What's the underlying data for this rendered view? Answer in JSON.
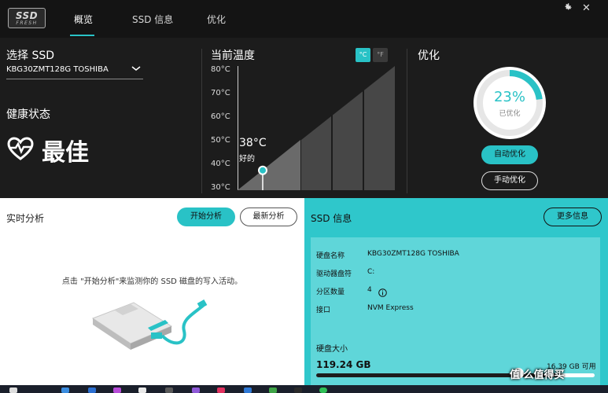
{
  "header": {
    "logo_line1": "SSD",
    "logo_line2": "FRESH",
    "tabs": [
      {
        "label": "概览",
        "active": true
      },
      {
        "label": "SSD 信息",
        "active": false
      },
      {
        "label": "优化",
        "active": false
      }
    ],
    "settings_icon": "gear-icon",
    "close_icon": "close-icon",
    "close_glyph": "✕"
  },
  "select_ssd": {
    "title": "选择 SSD",
    "value": "KBG30ZMT128G TOSHIBA"
  },
  "health": {
    "title": "健康状态",
    "status": "最佳",
    "icon": "heart-pulse-icon"
  },
  "temperature": {
    "title": "当前温度",
    "units": [
      "°C",
      "°F"
    ],
    "active_unit": "°C",
    "ticks": [
      "80°C",
      "70°C",
      "60°C",
      "50°C",
      "40°C",
      "30°C"
    ],
    "current": "38°C",
    "state": "好的",
    "current_value": 38,
    "range": [
      30,
      80
    ]
  },
  "optimize": {
    "title": "优化",
    "percent_text": "23%",
    "percent": 23,
    "label": "已优化",
    "auto_label": "自动优化",
    "manual_label": "手动优化"
  },
  "realtime": {
    "title": "实时分析",
    "start_label": "开始分析",
    "latest_label": "最新分析",
    "hint": "点击 \"开始分析\"来监测你的 SSD 磁盘的写入活动。"
  },
  "ssd_info": {
    "title": "SSD 信息",
    "more_label": "更多信息",
    "rows": [
      {
        "key": "硬盘名称",
        "value": "KBG30ZMT128G TOSHIBA"
      },
      {
        "key": "驱动器盘符",
        "value": "C:"
      },
      {
        "key": "分区数量",
        "value": "4"
      },
      {
        "key": "接口",
        "value": "NVM Express"
      }
    ],
    "partition_help_icon": "info-icon",
    "capacity_title": "硬盘大小",
    "capacity_used": "119.24 GB",
    "capacity_free": "16.39 GB 可用",
    "used_fraction": 0.88
  },
  "watermark": "值 么值得买",
  "colors": {
    "accent": "#29c2c6",
    "panel_dark": "#1c1c1c",
    "info_bg": "#2fc7cb"
  }
}
